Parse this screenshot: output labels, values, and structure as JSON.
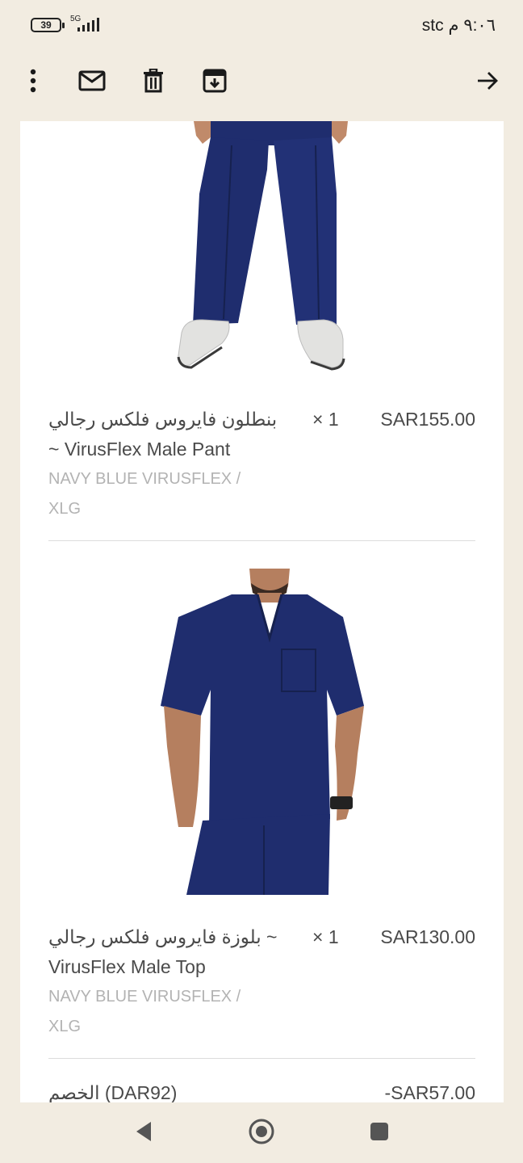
{
  "status_bar": {
    "battery_level": "39",
    "network": "5G",
    "carrier_time": "stc ٩:٠٦ م"
  },
  "toolbar": {
    "icons": [
      "more-vert-icon",
      "mail-icon",
      "delete-icon",
      "archive-icon",
      "forward-arrow-icon"
    ]
  },
  "items": [
    {
      "title": "بنطلون فايروس فلكس رجالي ~ VirusFlex Male Pant",
      "quantity": "× 1",
      "price": "SAR155.00",
      "variant": "NAVY BLUE VIRUSFLEX / XLG"
    },
    {
      "title": "بلوزة فايروس فلكس رجالي ~ VirusFlex Male Top",
      "quantity": "× 1",
      "price": "SAR130.00",
      "variant": "NAVY BLUE VIRUSFLEX / XLG"
    }
  ],
  "discount": {
    "label": "الخصم (DAR92)",
    "value": "-SAR57.00"
  },
  "nav": {
    "icons": [
      "back-triangle-icon",
      "home-circle-icon",
      "recents-square-icon"
    ]
  },
  "colors": {
    "background": "#f2ece1",
    "card": "#ffffff",
    "navy": "#1f2d6e"
  }
}
